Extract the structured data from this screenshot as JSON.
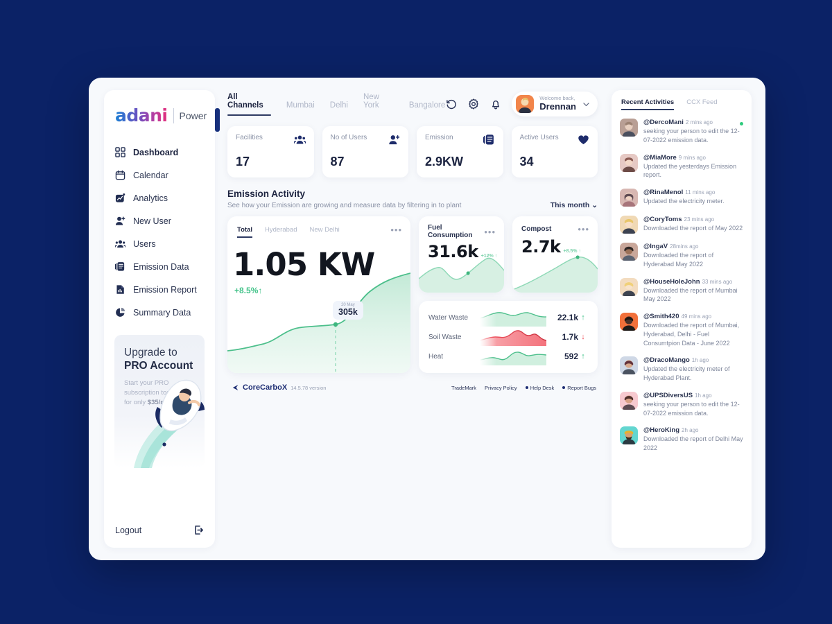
{
  "brand": {
    "logo_primary": "adani",
    "logo_secondary": "Power",
    "accent_gradient": "#1a7fd4 → #e52d7a",
    "page_background": "#0b2266"
  },
  "sidebar": {
    "items": [
      {
        "label": "Dashboard",
        "icon": "grid-icon",
        "active": true
      },
      {
        "label": "Calendar",
        "icon": "calendar-icon",
        "active": false
      },
      {
        "label": "Analytics",
        "icon": "analytics-icon",
        "active": false
      },
      {
        "label": "New User",
        "icon": "user-plus-icon",
        "active": false
      },
      {
        "label": "Users",
        "icon": "users-icon",
        "active": false
      },
      {
        "label": "Emission Data",
        "icon": "layers-icon",
        "active": false
      },
      {
        "label": "Emission Report",
        "icon": "report-icon",
        "active": false
      },
      {
        "label": "Summary Data",
        "icon": "pie-chart-icon",
        "active": false
      }
    ],
    "promo": {
      "line1": "Upgrade to",
      "line2": "PRO Account",
      "sub_a": "Start your PRO subscription today for only ",
      "sub_b": "$35/month"
    },
    "logout_label": "Logout"
  },
  "topbar": {
    "channels": [
      {
        "label": "All Channels",
        "active": true
      },
      {
        "label": "Mumbai",
        "active": false
      },
      {
        "label": "Delhi",
        "active": false
      },
      {
        "label": "New York",
        "active": false
      },
      {
        "label": "Bangalore",
        "active": false
      }
    ],
    "icons": [
      "history-icon",
      "gear-icon",
      "bell-icon"
    ],
    "user": {
      "greeting": "Welcome back,",
      "name": "Drennan"
    }
  },
  "stats": [
    {
      "label": "Facilities",
      "value": "17",
      "icon": "users-group-icon"
    },
    {
      "label": "No of Users",
      "value": "87",
      "icon": "user-plus-icon"
    },
    {
      "label": "Emission",
      "value": "2.9KW",
      "icon": "layers-icon"
    },
    {
      "label": "Active Users",
      "value": "34",
      "icon": "heart-icon"
    }
  ],
  "section": {
    "title": "Emission Activity",
    "subtitle": "See how your Emission are growing and measure data by filtering in to plant",
    "filter": "This month"
  },
  "chart_data": [
    {
      "type": "area",
      "title": "Total",
      "tabs": [
        "Total",
        "Hyderabad",
        "New Delhi"
      ],
      "active_tab": "Total",
      "value": "1.05 KW",
      "delta": "+8.5%",
      "delta_direction": "up",
      "tooltip": {
        "date": "20 May",
        "value": "305k"
      },
      "line_color": "#4cbf8b",
      "fill_color": "#d9f0e4",
      "x": [
        0,
        1,
        2,
        3,
        4,
        5,
        6,
        7,
        8,
        9,
        10
      ],
      "values": [
        18,
        20,
        23,
        26,
        36,
        42,
        44,
        46,
        62,
        82,
        92
      ],
      "ylim": [
        0,
        100
      ],
      "grid": false
    },
    {
      "type": "area",
      "title": "Fuel Consumption",
      "value": "31.6k",
      "delta": "+12%",
      "delta_direction": "up",
      "line_color": "#8fd9b7",
      "fill_color": "#d7f0e3",
      "x": [
        0,
        1,
        2,
        3,
        4,
        5,
        6,
        7,
        8
      ],
      "values": [
        34,
        52,
        58,
        40,
        30,
        38,
        50,
        72,
        54
      ],
      "ylim": [
        0,
        100
      ],
      "grid": false
    },
    {
      "type": "area",
      "title": "Compost",
      "value": "2.7k",
      "delta": "+8.5%",
      "delta_direction": "up",
      "line_color": "#8fd9b7",
      "fill_color": "#d7f0e3",
      "x": [
        0,
        1,
        2,
        3,
        4,
        5,
        6
      ],
      "values": [
        6,
        20,
        36,
        52,
        66,
        72,
        58
      ],
      "ylim": [
        0,
        100
      ],
      "grid": false
    },
    {
      "type": "line",
      "title": "Waste metrics sparklines",
      "series": [
        {
          "name": "Water Waste",
          "value": "22.1k",
          "direction": "up",
          "color": "#4cbf8b",
          "values": [
            52,
            60,
            72,
            66,
            74,
            62,
            70,
            56,
            60
          ]
        },
        {
          "name": "Soil Waste",
          "value": "1.7k",
          "direction": "down",
          "color": "#ee4f5c",
          "values": [
            30,
            44,
            52,
            44,
            72,
            62,
            66,
            40,
            34
          ]
        },
        {
          "name": "Heat",
          "value": "592",
          "direction": "up",
          "color": "#4cbf8b",
          "values": [
            36,
            44,
            40,
            52,
            68,
            56,
            66,
            50,
            56
          ]
        }
      ],
      "ylim": [
        0,
        100
      ],
      "grid": false
    }
  ],
  "waste_panel": {
    "rows": [
      {
        "label": "Water Waste",
        "value": "22.1k",
        "arrow": "↑",
        "direction": "up"
      },
      {
        "label": "Soil Waste",
        "value": "1.7k",
        "arrow": "↓",
        "direction": "down"
      },
      {
        "label": "Heat",
        "value": "592",
        "arrow": "↑",
        "direction": "up"
      }
    ]
  },
  "activities": {
    "tabs": [
      {
        "label": "Recent Activities",
        "active": true
      },
      {
        "label": "CCX Feed",
        "active": false
      }
    ],
    "items": [
      {
        "user": "@DercoMani",
        "time": "2 mins ago",
        "text": "seeking your person to edit the 12-07-2022 emission data.",
        "unread": true,
        "avatar_color": "#b99f95"
      },
      {
        "user": "@MiaMore",
        "time": "9 mins ago",
        "text": "Updated the yesterdays Emission report.",
        "unread": false,
        "avatar_color": "#e6c9c4"
      },
      {
        "user": "@RinaMenol",
        "time": "11 mins ago",
        "text": "Updated the electricity meter.",
        "unread": false,
        "avatar_color": "#d8b7b2"
      },
      {
        "user": "@CoryToms",
        "time": "23 mins ago",
        "text": "Downloaded the report of May 2022",
        "unread": false,
        "avatar_color": "#f0d9b5"
      },
      {
        "user": "@IngaV",
        "time": "28mins ago",
        "text": "Downloaded the report of Hyderabad May 2022",
        "unread": false,
        "avatar_color": "#9c7a6b"
      },
      {
        "user": "@HouseHoleJohn",
        "time": "33 mins ago",
        "text": "Downloaded the report of Mumbai May 2022",
        "unread": false,
        "avatar_color": "#f3dcc0"
      },
      {
        "user": "@Smith420",
        "time": "49 mins ago",
        "text": "Downloaded the report of Mumbai, Hyderabad, Delhi - Fuel Consumtpion Data -  June 2022",
        "unread": false,
        "avatar_color": "#f2703a"
      },
      {
        "user": "@DracoMango",
        "time": "1h ago",
        "text": "Updated the electricity meter of Hyderabad Plant.",
        "unread": false,
        "avatar_color": "#cfd8e6"
      },
      {
        "user": "@UPSDiversUS",
        "time": "1h ago",
        "text": "seeking your person to edit the 12-07-2022 emission data.",
        "unread": false,
        "avatar_color": "#f7c9cf"
      },
      {
        "user": "@HeroKing",
        "time": "2h ago",
        "text": "Downloaded the report of Delhi May 2022",
        "unread": false,
        "avatar_color": "#63d6d0"
      }
    ]
  },
  "footer": {
    "product": "CoreCarboX",
    "version": "14.5.78 version",
    "links": [
      {
        "label": "TradeMark",
        "bullet": false
      },
      {
        "label": "Privacy Policy",
        "bullet": false
      },
      {
        "label": "Help Desk",
        "bullet": true
      },
      {
        "label": "Report Bugs",
        "bullet": true
      }
    ]
  }
}
